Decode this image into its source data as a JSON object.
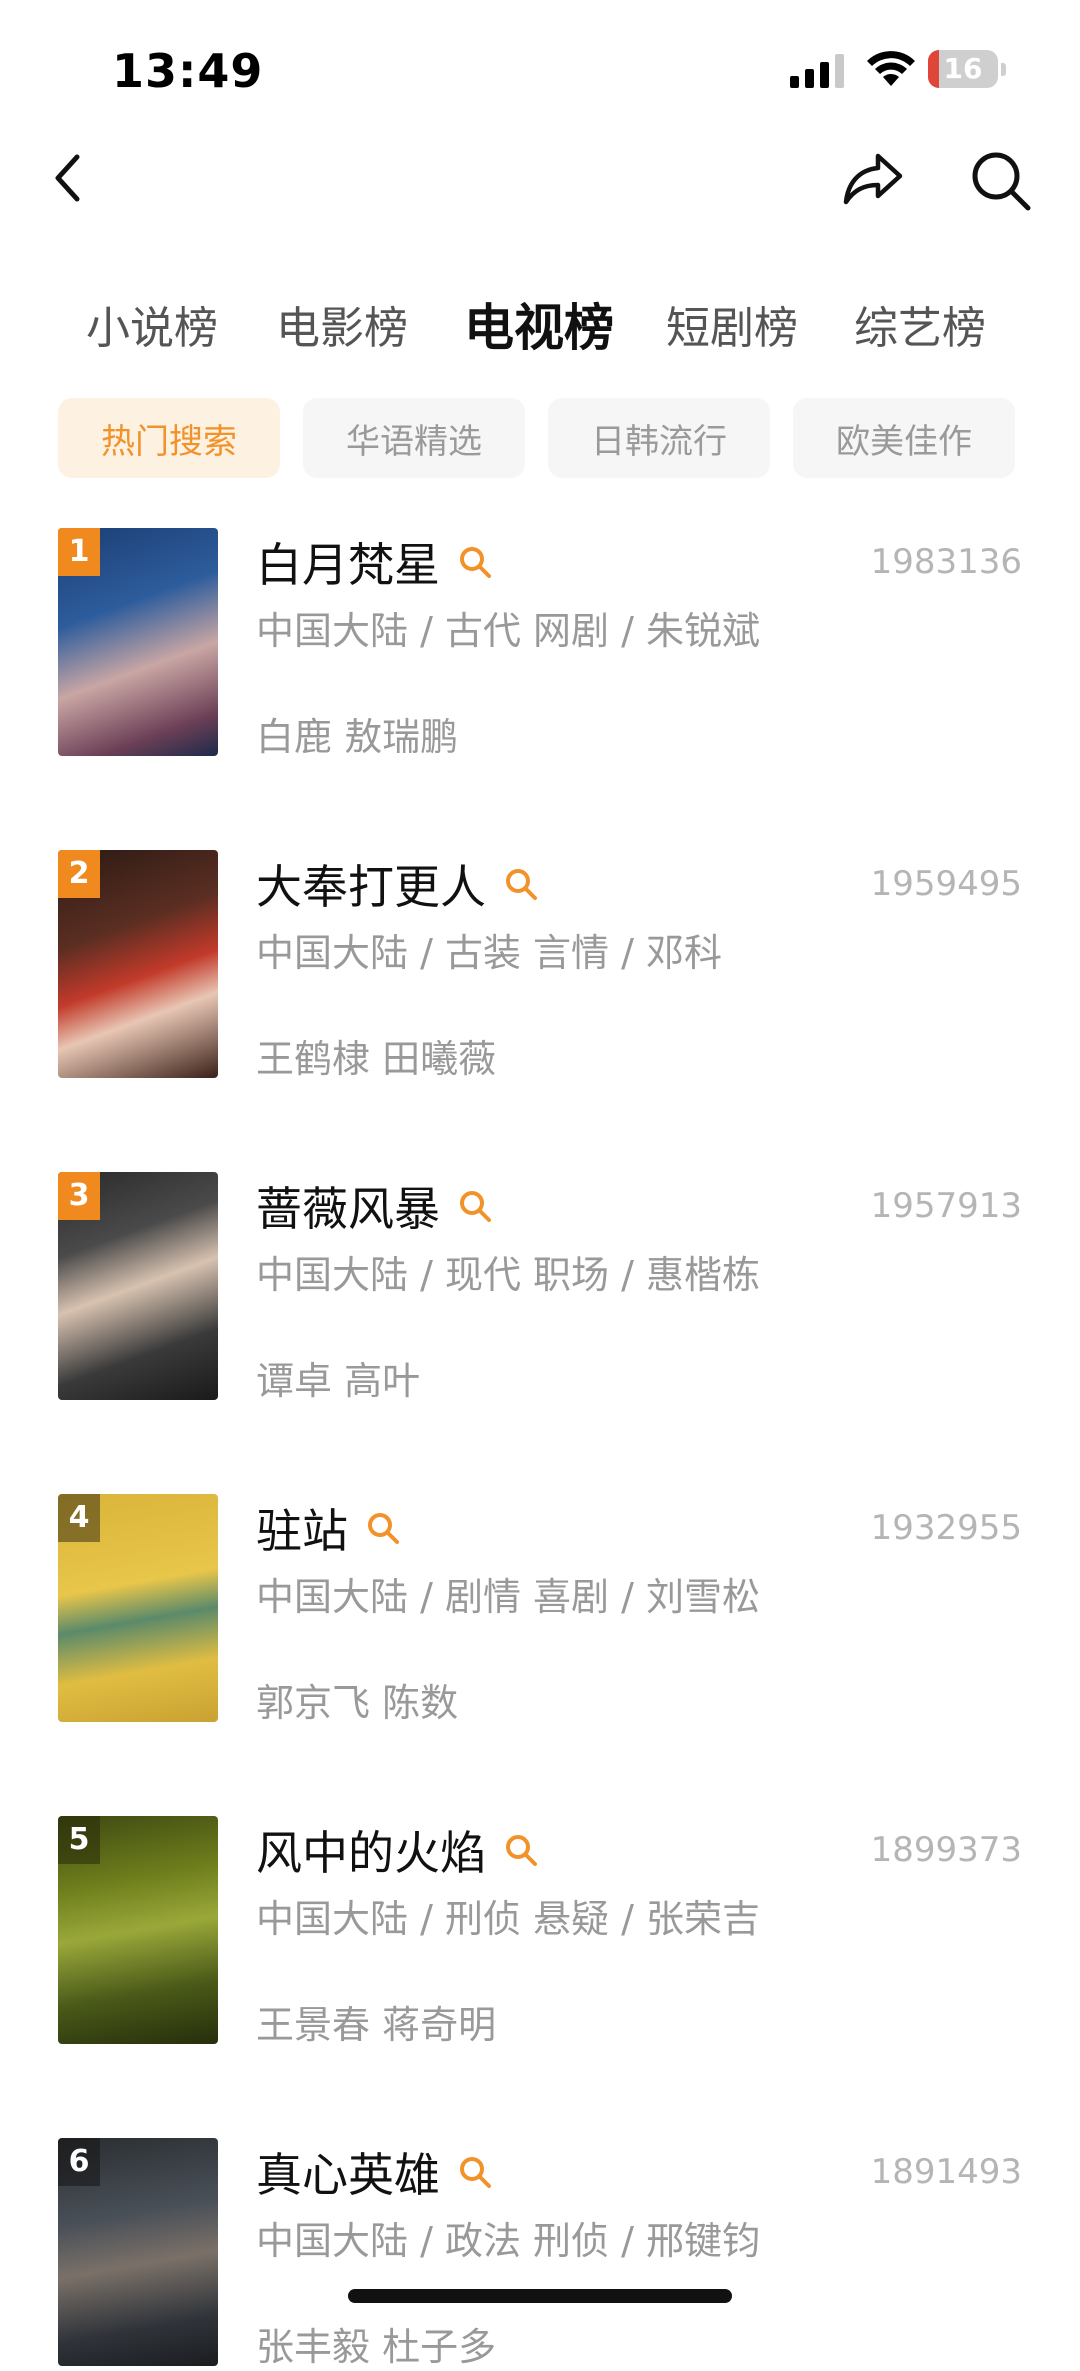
{
  "status_bar": {
    "time": "13:49",
    "battery": "16",
    "battery_level": 0.16
  },
  "nav": {
    "back_icon": "chevron-left-icon",
    "share_icon": "share-arrow-icon",
    "search_icon": "search-icon"
  },
  "tabs": [
    {
      "label": "小说榜",
      "active": false
    },
    {
      "label": "电影榜",
      "active": false
    },
    {
      "label": "电视榜",
      "active": true
    },
    {
      "label": "短剧榜",
      "active": false
    },
    {
      "label": "综艺榜",
      "active": false
    }
  ],
  "chips": [
    {
      "label": "热门搜索",
      "active": true
    },
    {
      "label": "华语精选",
      "active": false
    },
    {
      "label": "日韩流行",
      "active": false
    },
    {
      "label": "欧美佳作",
      "active": false
    }
  ],
  "colors": {
    "accent": "#f2922a",
    "rank_badge": "#f08a1f",
    "chip_active_bg": "#fdf1e2"
  },
  "items": [
    {
      "rank": "1",
      "title": "白月梵星",
      "score": "1983136",
      "meta": "中国大陆 / 古代 网剧 / 朱锐斌",
      "actors": "白鹿 敖瑞鹏"
    },
    {
      "rank": "2",
      "title": "大奉打更人",
      "score": "1959495",
      "meta": "中国大陆 / 古装 言情 / 邓科",
      "actors": "王鹤棣 田曦薇"
    },
    {
      "rank": "3",
      "title": "蔷薇风暴",
      "score": "1957913",
      "meta": "中国大陆 / 现代 职场 / 惠楷栋",
      "actors": "谭卓 高叶"
    },
    {
      "rank": "4",
      "title": "驻站",
      "score": "1932955",
      "meta": "中国大陆 / 剧情 喜剧 / 刘雪松",
      "actors": "郭京飞 陈数"
    },
    {
      "rank": "5",
      "title": "风中的火焰",
      "score": "1899373",
      "meta": "中国大陆 / 刑侦 悬疑 / 张荣吉",
      "actors": "王景春 蒋奇明"
    },
    {
      "rank": "6",
      "title": "真心英雄",
      "score": "1891493",
      "meta": "中国大陆 / 政法 刑侦 / 邢键钧",
      "actors": "张丰毅 杜子多"
    }
  ]
}
